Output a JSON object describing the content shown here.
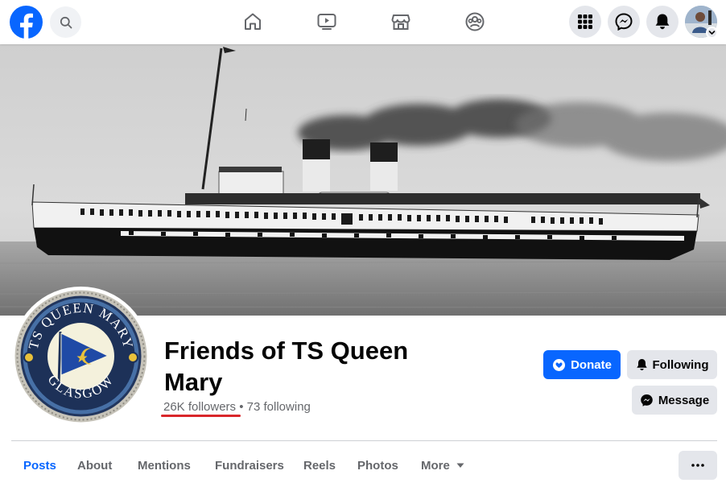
{
  "page": {
    "title": "Friends of TS Queen Mary",
    "followers": "26K followers",
    "separator": "•",
    "following": "73 following"
  },
  "profile_badge": {
    "top_text": "TS QUEEN MARY",
    "bottom_text": "GLASGOW"
  },
  "actions": {
    "donate": "Donate",
    "following": "Following",
    "message": "Message"
  },
  "tabs": [
    {
      "label": "Posts",
      "active": true
    },
    {
      "label": "About"
    },
    {
      "label": "Mentions"
    },
    {
      "label": "Fundraisers"
    },
    {
      "label": "Reels"
    },
    {
      "label": "Photos"
    },
    {
      "label": "More"
    }
  ],
  "icons": {
    "logo": "facebook-logo",
    "search": "search-icon",
    "nav": [
      "home-icon",
      "video-icon",
      "marketplace-icon",
      "groups-icon"
    ],
    "right": [
      "menu-grid-icon",
      "messenger-icon",
      "notifications-icon"
    ]
  },
  "colors": {
    "brand_blue": "#0866ff",
    "annotation_red": "#d9262a",
    "secondary_text": "#65676b",
    "button_grey": "#e4e6eb"
  }
}
